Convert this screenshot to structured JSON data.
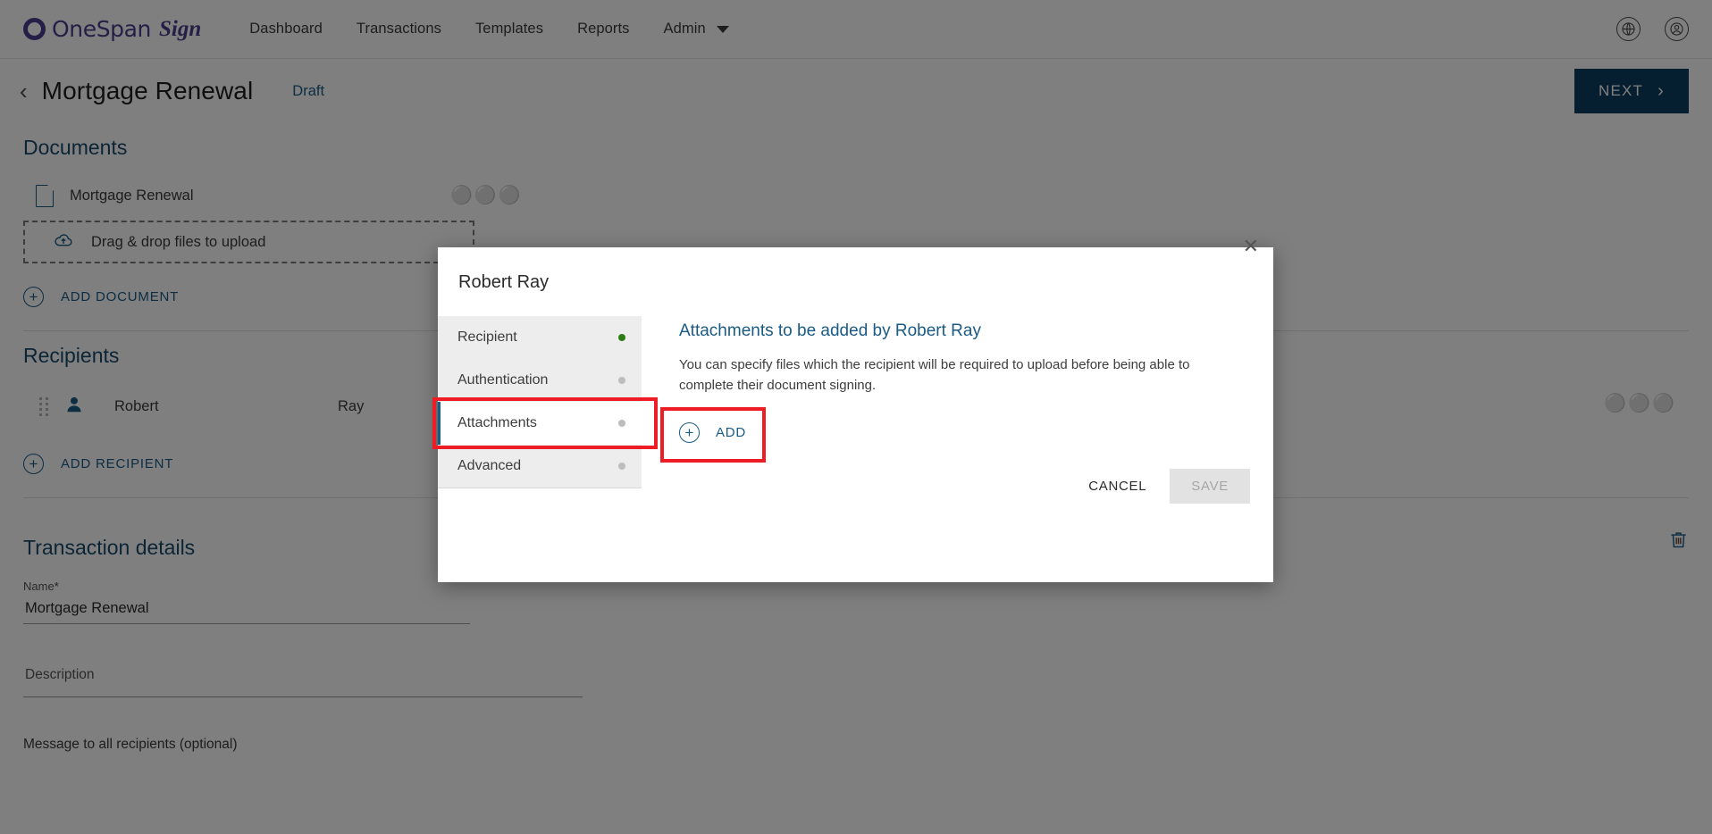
{
  "topnav": {
    "logo_text": "OneSpan",
    "logo_sign": "Sign",
    "links": [
      {
        "label": "Dashboard"
      },
      {
        "label": "Transactions"
      },
      {
        "label": "Templates"
      },
      {
        "label": "Reports"
      },
      {
        "label": "Admin"
      }
    ],
    "globe_icon": "globe-icon",
    "account_icon": "account-icon"
  },
  "header": {
    "back_icon": "back-chevron-icon",
    "title": "Mortgage Renewal",
    "status": "Draft",
    "next_label": "NEXT",
    "next_arrow": "›",
    "next_color": "#0b3c60"
  },
  "documents": {
    "section_title": "Documents",
    "items": [
      {
        "name": "Mortgage Renewal",
        "menu": "●●●"
      }
    ],
    "dropzone_label": "Drag & drop files to upload",
    "add_label": "ADD DOCUMENT"
  },
  "recipients": {
    "section_title": "Recipients",
    "rows": [
      {
        "first": "Robert",
        "last": "Ray"
      }
    ],
    "add_label": "ADD RECIPIENT"
  },
  "transaction": {
    "section_title": "Transaction details",
    "delete_icon": "trash-icon",
    "name_label": "Name",
    "name_required": "*",
    "name_value": "Mortgage Renewal",
    "description_label": "Description",
    "description_value": "",
    "message_label": "Message to all recipients (optional)"
  },
  "modal": {
    "title": "Robert Ray",
    "close_icon": "close-icon",
    "tabs": [
      {
        "label": "Recipient",
        "state": "done"
      },
      {
        "label": "Authentication",
        "state": "pending"
      },
      {
        "label": "Attachments",
        "state": "pending"
      },
      {
        "label": "Advanced",
        "state": "pending"
      }
    ],
    "active_tab_index": 2,
    "heading": "Attachments to be added by Robert Ray",
    "description": "You can specify files which the recipient will be required to upload before being able to complete their document signing.",
    "add_label": "ADD",
    "cancel_label": "CANCEL",
    "save_label": "SAVE",
    "highlight_color": "#ee1c25",
    "accent_color": "#1a5b86"
  }
}
